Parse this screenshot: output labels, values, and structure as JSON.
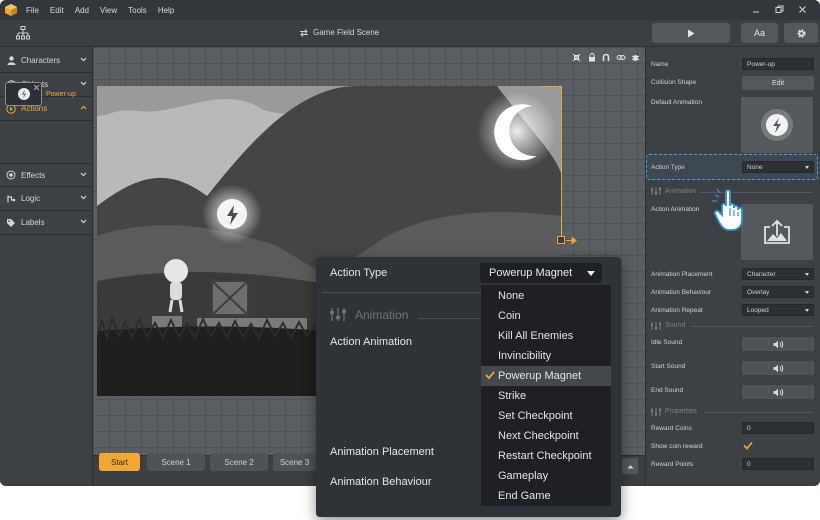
{
  "menu": {
    "items": [
      "File",
      "Edit",
      "Add",
      "View",
      "Tools",
      "Help"
    ]
  },
  "toolbar": {
    "scene_title": "Game Field Scene",
    "font_button_label": "Aa"
  },
  "sidebar": {
    "items": [
      {
        "label": "Characters"
      },
      {
        "label": "Objects"
      },
      {
        "label": "Actions"
      },
      {
        "label": "Effects"
      },
      {
        "label": "Logic"
      },
      {
        "label": "Labels"
      }
    ],
    "asset_label": "Power-up"
  },
  "scenes": {
    "tabs": [
      "Start",
      "Scene 1",
      "Scene 2",
      "Scene 3"
    ]
  },
  "properties": {
    "name_label": "Name",
    "name_value": "Power-up",
    "collision_label": "Collision Shape",
    "collision_button": "Edit",
    "default_animation_label": "Default Animation",
    "action_type_label": "Action Type",
    "action_type_value": "None",
    "animation_section": "Animation",
    "action_animation_label": "Action Animation",
    "animation_placement_label": "Animation Placement",
    "animation_placement_value": "Character",
    "animation_behaviour_label": "Animation Behaviour",
    "animation_behaviour_value": "Overlay",
    "animation_repeat_label": "Animation Repeat",
    "animation_repeat_value": "Looped",
    "sound_section": "Sound",
    "idle_sound_label": "Idle Sound",
    "start_sound_label": "Start Sound",
    "end_sound_label": "End Sound",
    "properties_section": "Properties",
    "reward_coins_label": "Reward Coins",
    "reward_coins_value": "0",
    "show_coin_reward_label": "Show coin reward",
    "reward_points_label": "Reward Points",
    "reward_points_value": "0"
  },
  "popup": {
    "action_type_label": "Action Type",
    "action_type_value": "Powerup Magnet",
    "animation_section": "Animation",
    "action_animation_label": "Action Animation",
    "animation_placement_label": "Animation Placement",
    "animation_behaviour_label": "Animation Behaviour",
    "options": [
      "None",
      "Coin",
      "Kill All Enemies",
      "Invincibility",
      "Powerup Magnet",
      "Strike",
      "Set Checkpoint",
      "Next Checkpoint",
      "Restart Checkpoint",
      "Gameplay",
      "End Game"
    ],
    "selected_option": "Powerup Magnet"
  },
  "colors": {
    "accent": "#f0a830",
    "highlight": "#3aa6e8"
  }
}
